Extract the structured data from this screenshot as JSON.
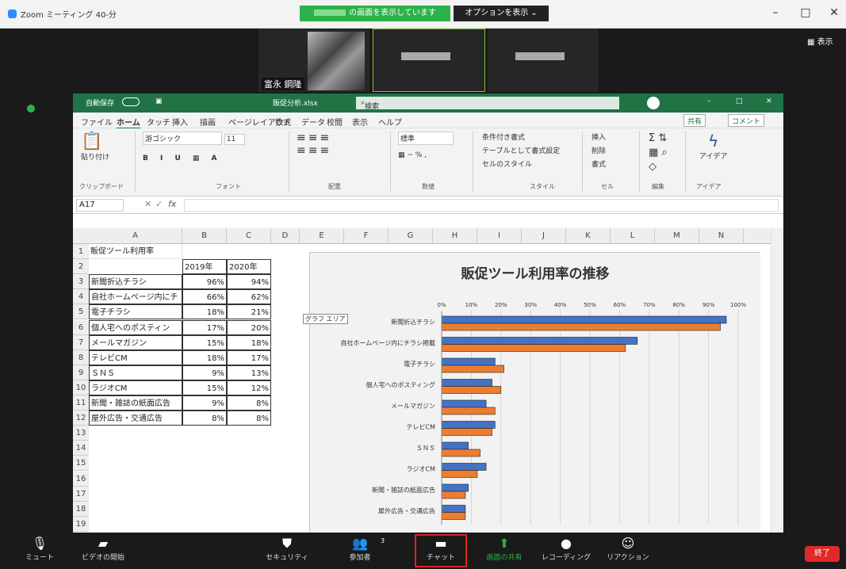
{
  "zoom": {
    "title": "Zoom ミーティング 40-分",
    "share_banner": "の画面を表示しています",
    "options": "オプションを表示 ⌄",
    "view": "表示",
    "participant_name": "富永 鋼隆",
    "end": "終了",
    "controls": [
      {
        "icon": "mic-icon",
        "label": "ミュート"
      },
      {
        "icon": "video-off-icon",
        "label": "ビデオの開始"
      },
      {
        "icon": "shield-icon",
        "label": "セキュリティ"
      },
      {
        "icon": "participants-icon",
        "label": "参加者"
      },
      {
        "icon": "chat-icon",
        "label": "チャット"
      },
      {
        "icon": "share-screen-icon",
        "label": "画面の共有"
      },
      {
        "icon": "record-icon",
        "label": "レコーディング"
      },
      {
        "icon": "reaction-icon",
        "label": "リアクション"
      }
    ],
    "participant_count": "3"
  },
  "excel": {
    "autosave": "自動保存",
    "filename": "販促分析.xlsx",
    "search": "検索",
    "tabs": [
      "ファイル",
      "ホーム",
      "タッチ",
      "挿入",
      "描画",
      "ページレイアウト",
      "数式",
      "データ",
      "校閲",
      "表示",
      "ヘルプ"
    ],
    "share": "共有",
    "comment": "コメント",
    "ribbon": {
      "clipboard": "クリップボード",
      "paste": "貼り付け",
      "font": "フォント",
      "font_name": "游ゴシック",
      "font_size": "11",
      "align": "配置",
      "number": "数値",
      "number_format": "標準",
      "styles": "スタイル",
      "style_items": [
        "条件付き書式",
        "テーブルとして書式設定",
        "セルのスタイル"
      ],
      "cells": "セル",
      "cell_items": [
        "挿入",
        "削除",
        "書式"
      ],
      "edit": "編集",
      "ideas": "アイデア",
      "ideas_btn": "アイデア"
    },
    "namebox": "A17",
    "fx": "fx",
    "columns": [
      "A",
      "B",
      "C",
      "D",
      "E",
      "F",
      "G",
      "H",
      "I",
      "J",
      "K",
      "L",
      "M",
      "N"
    ],
    "table": {
      "title": "販促ツール利用率",
      "headers": [
        "2019年",
        "2020年"
      ],
      "rows": [
        [
          "新聞折込チラシ",
          "96%",
          "94%"
        ],
        [
          "自社ホームページ内にチ",
          "66%",
          "62%"
        ],
        [
          "電子チラシ",
          "18%",
          "21%"
        ],
        [
          "個人宅へのポスティン",
          "17%",
          "20%"
        ],
        [
          "メールマガジン",
          "15%",
          "18%"
        ],
        [
          "テレビCM",
          "18%",
          "17%"
        ],
        [
          "ＳＮＳ",
          "9%",
          "13%"
        ],
        [
          "ラジオCM",
          "15%",
          "12%"
        ],
        [
          "新聞・雑誌の紙面広告",
          "9%",
          "8%"
        ],
        [
          "屋外広告・交通広告",
          "8%",
          "8%"
        ]
      ]
    },
    "tooltip": "グラフ エリア"
  },
  "chart_data": {
    "type": "bar",
    "orientation": "horizontal",
    "title": "販促ツール利用率の推移",
    "categories": [
      "新聞折込チラシ",
      "自社ホームページ内にチラシ掲載",
      "電子チラシ",
      "個人宅へのポスティング",
      "メールマガジン",
      "テレビCM",
      "ＳＮＳ",
      "ラジオCM",
      "新聞・雑誌の紙面広告",
      "屋外広告・交通広告"
    ],
    "series": [
      {
        "name": "2019年",
        "color": "#4472c4",
        "values": [
          96,
          66,
          18,
          17,
          15,
          18,
          9,
          15,
          9,
          8
        ]
      },
      {
        "name": "2020年",
        "color": "#ed7d31",
        "values": [
          94,
          62,
          21,
          20,
          18,
          17,
          13,
          12,
          8,
          8
        ]
      }
    ],
    "xlim": [
      0,
      100
    ],
    "xticks": [
      "0%",
      "10%",
      "20%",
      "30%",
      "40%",
      "50%",
      "60%",
      "70%",
      "80%",
      "90%",
      "100%"
    ],
    "grid": true
  }
}
